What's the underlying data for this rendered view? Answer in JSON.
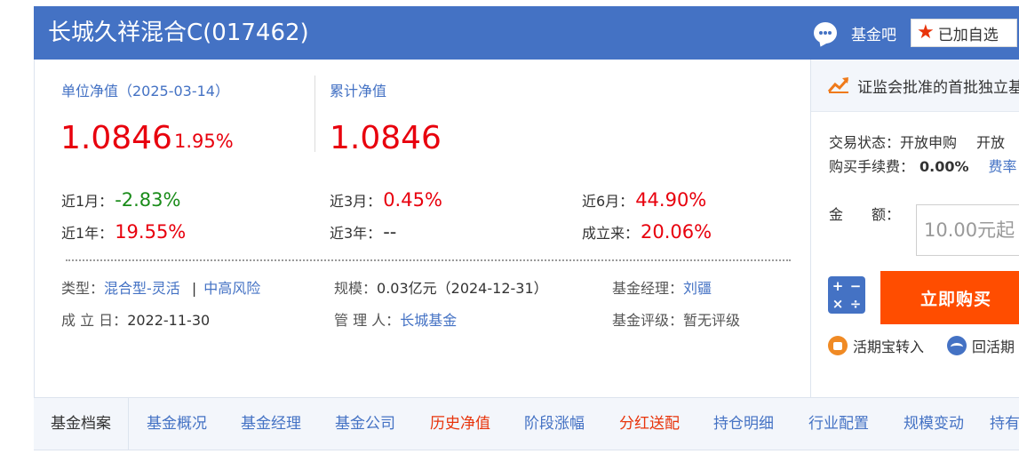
{
  "header": {
    "title": "长城久祥混合C(017462)",
    "forum_label": "基金吧",
    "watchlist_label": "已加自选"
  },
  "nav": {
    "unit_label": "单位净值（2025-03-14）",
    "unit_value": "1.0846",
    "unit_change": "1.95%",
    "acc_label": "累计净值",
    "acc_value": "1.0846"
  },
  "performance": [
    {
      "label": "近1月：",
      "value": "-2.83%",
      "trend": "down"
    },
    {
      "label": "近3月：",
      "value": "0.45%",
      "trend": "up"
    },
    {
      "label": "近6月：",
      "value": "44.90%",
      "trend": "up"
    },
    {
      "label": "近1年：",
      "value": "19.55%",
      "trend": "up"
    },
    {
      "label": "近3年：",
      "value": "--",
      "trend": "flat"
    },
    {
      "label": "成立来：",
      "value": "20.06%",
      "trend": "up"
    }
  ],
  "info": {
    "type_label": "类型：",
    "type_value": "混合型-灵活",
    "type_sep": "|",
    "risk": "中高风险",
    "scale_label": "规模：",
    "scale_value": "0.03亿元（2024-12-31）",
    "manager_label": "基金经理：",
    "manager_value": "刘疆",
    "inception_label": "成 立 日：",
    "inception_value": "2022-11-30",
    "company_label": "管 理 人：",
    "company_value": "长城基金",
    "rating_label": "基金评级：",
    "rating_value": "暂无评级"
  },
  "side": {
    "promo": "证监会批准的首批独立基",
    "status_label": "交易状态：",
    "status_value": "开放申购",
    "status_value2": "开放",
    "fee_label": "购买手续费：",
    "fee_value": "0.00%",
    "fee_link": "费率",
    "amount_label": "金　　额：",
    "amount_placeholder": "10.00元起",
    "buy_label": "立即购买",
    "link1": "活期宝转入",
    "link2": "回活期"
  },
  "tabs": [
    "基金档案",
    "基金概况",
    "基金经理",
    "基金公司",
    "历史净值",
    "阶段涨幅",
    "分红送配",
    "持仓明细",
    "行业配置",
    "规模变动",
    "持有人"
  ],
  "colors": {
    "brand": "#4472c4",
    "up": "#e8000d",
    "down": "#1a8c1a",
    "buy": "#ff4d00"
  }
}
